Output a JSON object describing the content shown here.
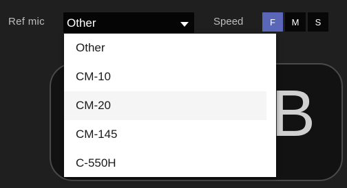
{
  "toolbar": {
    "ref_mic_label": "Ref mic",
    "selected_mic": "Other",
    "speed_label": "Speed",
    "speed_options": [
      "F",
      "M",
      "S"
    ],
    "speed_selected": "F"
  },
  "dropdown": {
    "options": [
      "Other",
      "CM-10",
      "CM-20",
      "CM-145",
      "C-550H"
    ],
    "hover_index": 2
  },
  "background": {
    "big_letter": "B"
  },
  "colors": {
    "accent": "#5a67b9",
    "background": "#1f1f1f"
  }
}
